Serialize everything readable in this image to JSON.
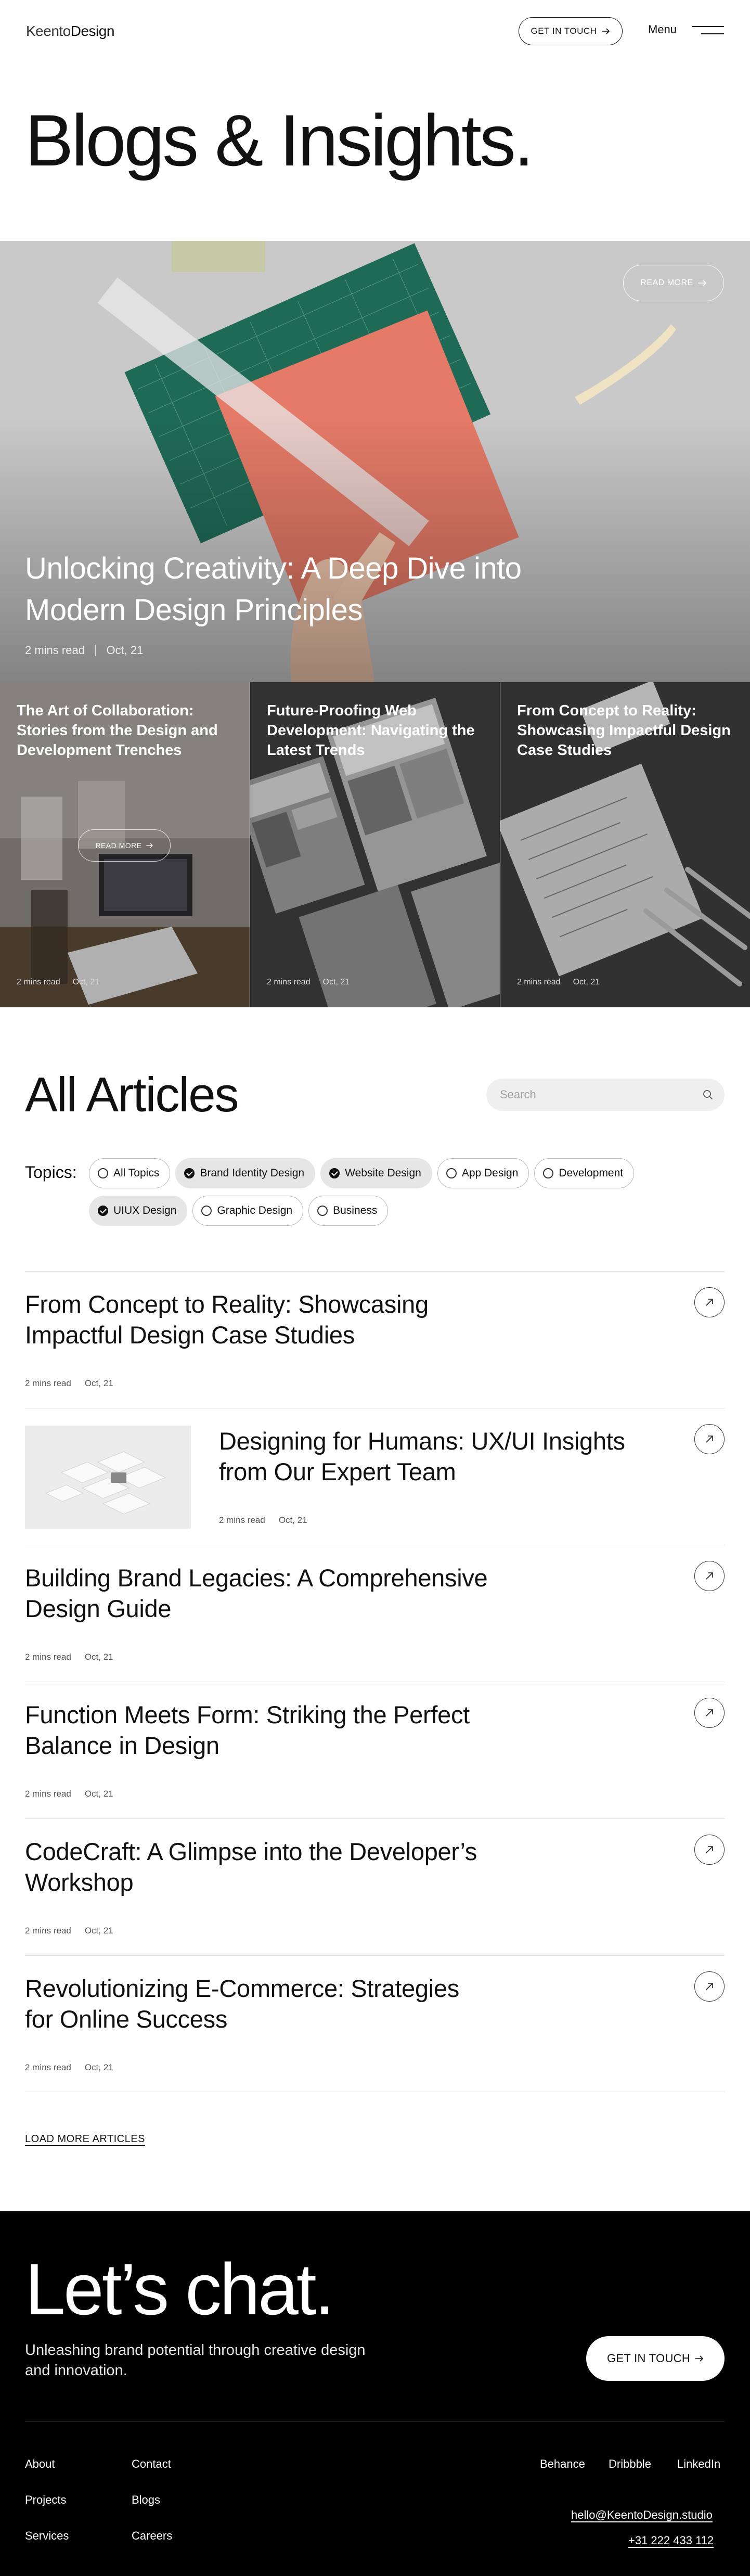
{
  "header": {
    "logo_light": "Keento",
    "logo_bold": "Design",
    "cta_label": "GET IN TOUCH",
    "menu_label": "Menu"
  },
  "page_title": "Blogs & Insights.",
  "hero": {
    "read_more_label": "READ MORE",
    "title": "Unlocking Creativity: A Deep Dive into Modern Design Principles",
    "read_time": "2 mins read",
    "date": "Oct, 21"
  },
  "featured": [
    {
      "title": "The Art of Collaboration: Stories from the Design and Development Trenches",
      "read_time": "2 mins read",
      "date": "Oct, 21",
      "read_more_label": "READ MORE"
    },
    {
      "title": "Future-Proofing Web Development: Navigating the Latest Trends",
      "read_time": "2 mins read",
      "date": "Oct, 21"
    },
    {
      "title": "From Concept to Reality: Showcasing Impactful Design Case Studies",
      "read_time": "2 mins read",
      "date": "Oct, 21"
    }
  ],
  "articles_section": {
    "title": "All Articles",
    "search_placeholder": "Search",
    "topics_label": "Topics:",
    "topics": [
      {
        "label": "All Topics",
        "selected": false
      },
      {
        "label": "Brand Identity Design",
        "selected": true
      },
      {
        "label": "Website Design",
        "selected": true
      },
      {
        "label": "App Design",
        "selected": false
      },
      {
        "label": "Development",
        "selected": false
      },
      {
        "label": "UIUX Design",
        "selected": true
      },
      {
        "label": "Graphic Design",
        "selected": false
      },
      {
        "label": "Business",
        "selected": false
      }
    ],
    "articles": [
      {
        "title": "From Concept to Reality: Showcasing Impactful Design Case Studies",
        "read_time": "2 mins read",
        "date": "Oct, 21"
      },
      {
        "title": "Designing for Humans: UX/UI Insights from Our Expert Team",
        "read_time": "2 mins read",
        "date": "Oct, 21"
      },
      {
        "title": "Building Brand Legacies: A Comprehensive Design Guide",
        "read_time": "2 mins read",
        "date": "Oct, 21"
      },
      {
        "title": "Function Meets Form: Striking the Perfect Balance in Design",
        "read_time": "2 mins read",
        "date": "Oct, 21"
      },
      {
        "title": "CodeCraft: A Glimpse into the Developer’s Workshop",
        "read_time": "2 mins read",
        "date": "Oct, 21"
      },
      {
        "title": "Revolutionizing E-Commerce: Strategies for Online Success",
        "read_time": "2 mins read",
        "date": "Oct, 21"
      }
    ],
    "load_more_label": "LOAD MORE ARTICLES"
  },
  "footer": {
    "headline": "Let’s chat.",
    "subtitle": "Unleashing brand potential through creative design and innovation.",
    "cta_label": "GET IN TOUCH",
    "nav": {
      "about": "About",
      "contact": "Contact",
      "projects": "Projects",
      "blogs": "Blogs",
      "services": "Services",
      "careers": "Careers"
    },
    "social": {
      "behance": "Behance",
      "dribbble": "Dribbble",
      "linkedin": "LinkedIn"
    },
    "email": "hello@KeentoDesign.studio",
    "phone": "+31 222 433 112"
  },
  "colors": {
    "accent": "#000000",
    "background": "#ffffff",
    "chip_selected": "#e6e6e6"
  }
}
